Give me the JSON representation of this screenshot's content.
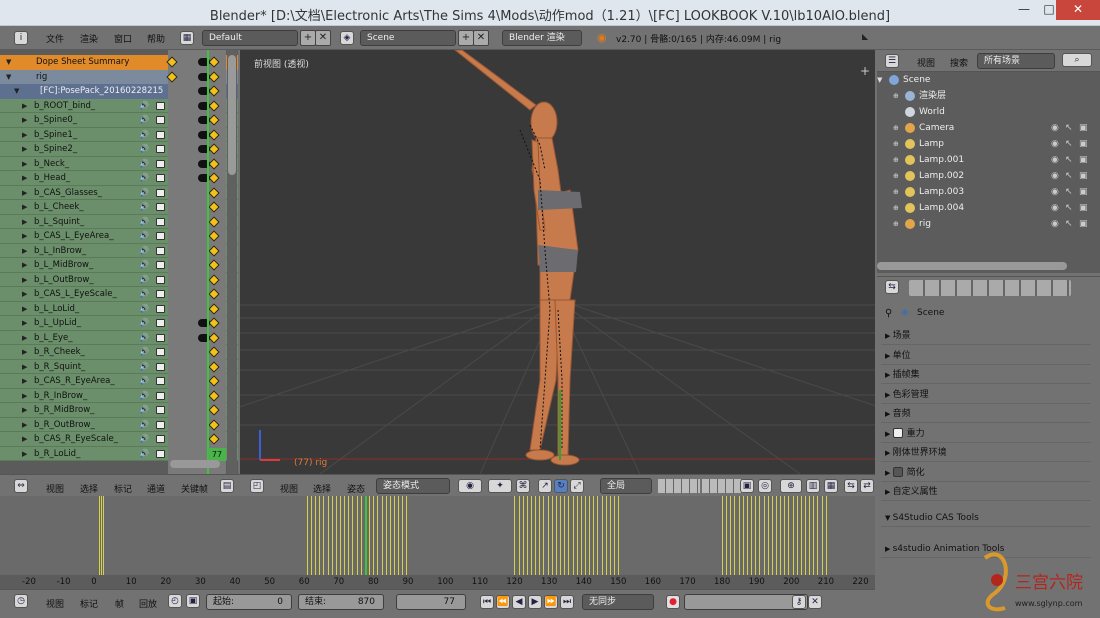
{
  "window": {
    "title": "Blender* [D:\\文档\\Electronic Arts\\The Sims 4\\Mods\\动作mod（1.21）\\[FC] LOOKBOOK V.10\\lb10AIO.blend]",
    "min": "—",
    "max": "□",
    "close": "✕"
  },
  "topbar": {
    "menus": [
      "文件",
      "渲染",
      "窗口",
      "帮助"
    ],
    "layout": "Default",
    "scene": "Scene",
    "engine": "Blender 渲染",
    "status": "v2.70 | 骨骼:0/165 | 内存:46.09M | rig"
  },
  "dope": {
    "rows": [
      {
        "label": "Dope Sheet Summary",
        "kind": "summary"
      },
      {
        "label": "rig",
        "kind": "rig"
      },
      {
        "label": "[FC]:PosePack_20160228215",
        "kind": "action"
      },
      {
        "label": "b_ROOT_bind_",
        "kind": "bone"
      },
      {
        "label": "b_Spine0_",
        "kind": "bone"
      },
      {
        "label": "b_Spine1_",
        "kind": "bone"
      },
      {
        "label": "b_Spine2_",
        "kind": "bone"
      },
      {
        "label": "b_Neck_",
        "kind": "bone"
      },
      {
        "label": "b_Head_",
        "kind": "bone"
      },
      {
        "label": "b_CAS_Glasses_",
        "kind": "bone"
      },
      {
        "label": "b_L_Cheek_",
        "kind": "bone"
      },
      {
        "label": "b_L_Squint_",
        "kind": "bone"
      },
      {
        "label": "b_CAS_L_EyeArea_",
        "kind": "bone"
      },
      {
        "label": "b_L_InBrow_",
        "kind": "bone"
      },
      {
        "label": "b_L_MidBrow_",
        "kind": "bone"
      },
      {
        "label": "b_L_OutBrow_",
        "kind": "bone"
      },
      {
        "label": "b_CAS_L_EyeScale_",
        "kind": "bone"
      },
      {
        "label": "b_L_LoLid_",
        "kind": "bone"
      },
      {
        "label": "b_L_UpLid_",
        "kind": "bone"
      },
      {
        "label": "b_L_Eye_",
        "kind": "bone"
      },
      {
        "label": "b_R_Cheek_",
        "kind": "bone"
      },
      {
        "label": "b_R_Squint_",
        "kind": "bone"
      },
      {
        "label": "b_CAS_R_EyeArea_",
        "kind": "bone"
      },
      {
        "label": "b_R_InBrow_",
        "kind": "bone"
      },
      {
        "label": "b_R_MidBrow_",
        "kind": "bone"
      },
      {
        "label": "b_R_OutBrow_",
        "kind": "bone"
      },
      {
        "label": "b_CAS_R_EyeScale_",
        "kind": "bone"
      },
      {
        "label": "b_R_LoLid_",
        "kind": "bone"
      }
    ],
    "frame_badge": "77",
    "header_menus": [
      "视图",
      "选择",
      "标记",
      "通道",
      "关键帧"
    ]
  },
  "viewport": {
    "title": "前视图 (透视)",
    "object": "(77) rig",
    "header_menus": [
      "视图",
      "选择",
      "姿态"
    ],
    "mode": "姿态模式",
    "pivot": "全局"
  },
  "timeline": {
    "ticks": [
      "-20",
      "-10",
      "0",
      "10",
      "20",
      "30",
      "40",
      "50",
      "60",
      "70",
      "80",
      "90",
      "100",
      "110",
      "120",
      "130",
      "140",
      "150",
      "160",
      "170",
      "180",
      "190",
      "200",
      "210",
      "220"
    ],
    "menus": [
      "视图",
      "标记",
      "帧",
      "回放"
    ],
    "start_label": "起始:",
    "start": "0",
    "end_label": "结束:",
    "end": "870",
    "current": "77",
    "sync": "无同步"
  },
  "outliner": {
    "menus": [
      "视图",
      "搜索"
    ],
    "filter": "所有场景",
    "items": [
      "Scene",
      "渲染层",
      "World",
      "Camera",
      "Lamp",
      "Lamp.001",
      "Lamp.002",
      "Lamp.003",
      "Lamp.004",
      "rig"
    ]
  },
  "properties": {
    "context": "Scene",
    "panels": [
      "场景",
      "单位",
      "插帧集",
      "色彩管理",
      "音频",
      "重力",
      "刚体世界环境",
      "简化",
      "自定义属性",
      "S4Studio CAS Tools",
      "s4studio Animation Tools"
    ]
  },
  "logo": {
    "name": "三宫六院",
    "url": "www.sglynp.com"
  }
}
